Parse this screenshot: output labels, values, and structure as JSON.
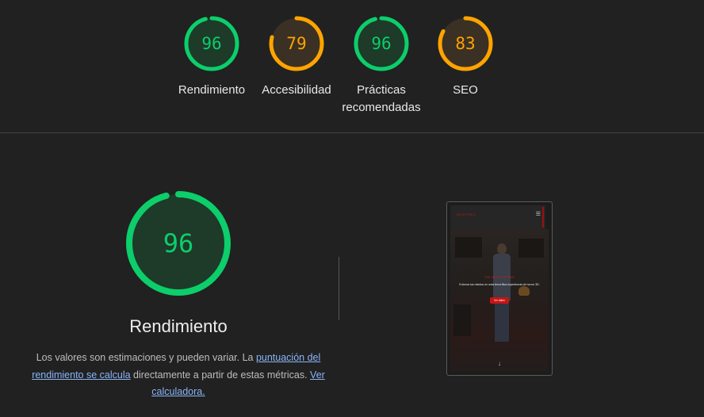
{
  "colors": {
    "pass": "#0cce6b",
    "average": "#ffa400",
    "pass_fill": "#1e3a29",
    "average_fill": "#3b3024",
    "link": "#8ab4f8"
  },
  "categories": [
    {
      "label": "Rendimiento",
      "score": "96",
      "level": "pass"
    },
    {
      "label": "Accesibilidad",
      "score": "79",
      "level": "average"
    },
    {
      "label": "Prácticas recomendadas",
      "score": "96",
      "level": "pass"
    },
    {
      "label": "SEO",
      "score": "83",
      "level": "average"
    }
  ],
  "performance": {
    "score": "96",
    "title": "Rendimiento",
    "desc_part1": "Los valores son estimaciones y pueden variar. La ",
    "desc_link1": "puntuación del rendimiento se calcula",
    "desc_part2": " directamente a partir de estas métricas. ",
    "desc_link2": "Ver calculadora."
  },
  "screenshot": {
    "logo": "NIGHTFALL",
    "menu_icon": "hamburger-icon",
    "tagline": "THE DEEPEST FEAR",
    "subtitle": "Entrena tus miedos en esta terrorífica experiencia de horror 3D.",
    "button": "Ver tráiler",
    "scroll_icon": "arrow-down-icon"
  }
}
